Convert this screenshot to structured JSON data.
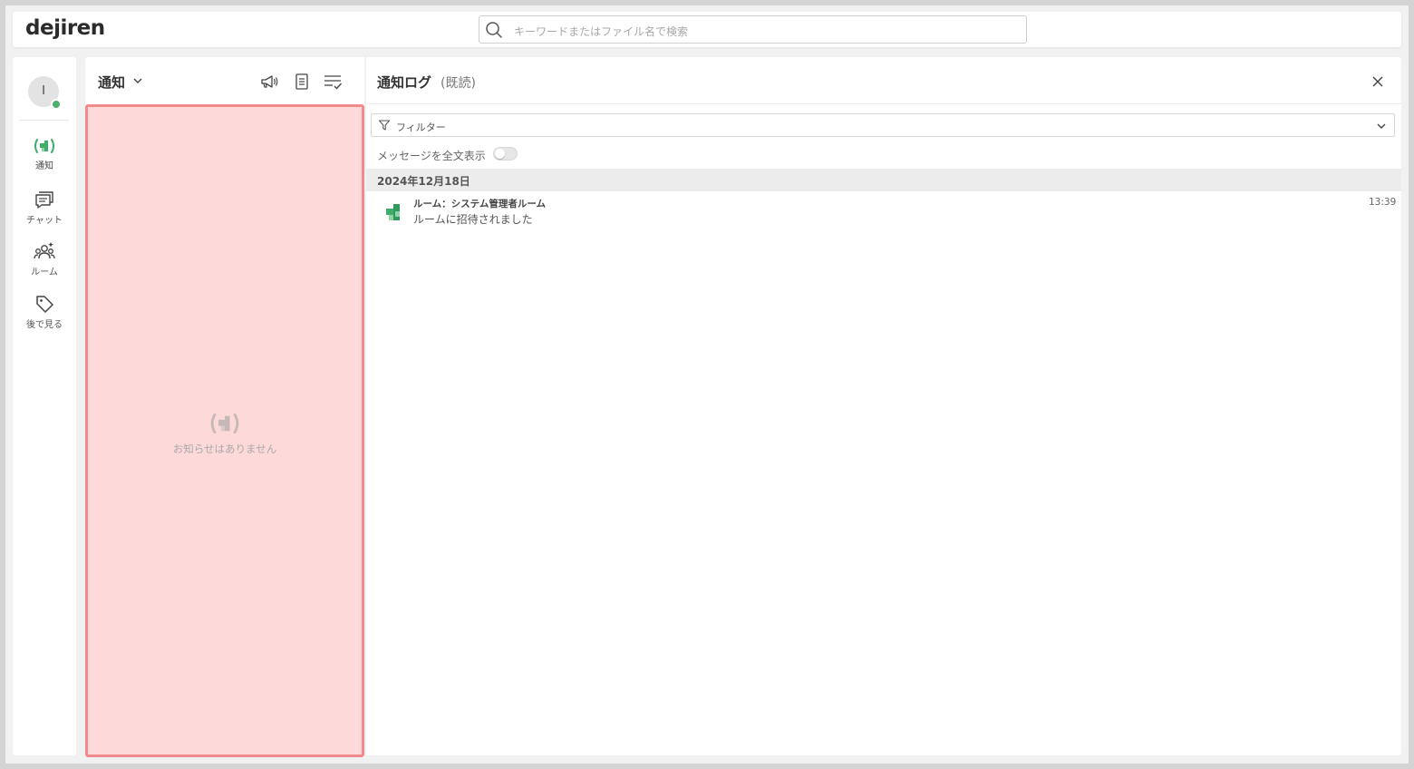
{
  "app": {
    "logo": "dejiren",
    "search_placeholder": "キーワードまたはファイル名で検索"
  },
  "user": {
    "initial": "I",
    "status_color": "#4caf6d"
  },
  "nav": {
    "items": [
      {
        "label": "通知",
        "icon": "notification-broadcast-icon",
        "active": true
      },
      {
        "label": "チャット",
        "icon": "chat-icon",
        "active": false
      },
      {
        "label": "ルーム",
        "icon": "room-group-icon",
        "active": false
      },
      {
        "label": "後で見る",
        "icon": "tag-icon",
        "active": false
      }
    ]
  },
  "notifications": {
    "title": "通知",
    "empty_message": "お知らせはありません"
  },
  "log": {
    "title": "通知ログ",
    "subtitle": "(既読)",
    "filter_label": "フィルター",
    "fulltext_label": "メッセージを全文表示",
    "fulltext_enabled": false,
    "groups": [
      {
        "date": "2024年12月18日",
        "items": [
          {
            "room": "ルーム：システム管理者ルーム",
            "message": "ルームに招待されました",
            "time": "13:39"
          }
        ]
      }
    ]
  },
  "colors": {
    "accent_green": "#3fae6a",
    "highlight_fill": "#fdd9da",
    "highlight_border": "#f18a8c"
  }
}
